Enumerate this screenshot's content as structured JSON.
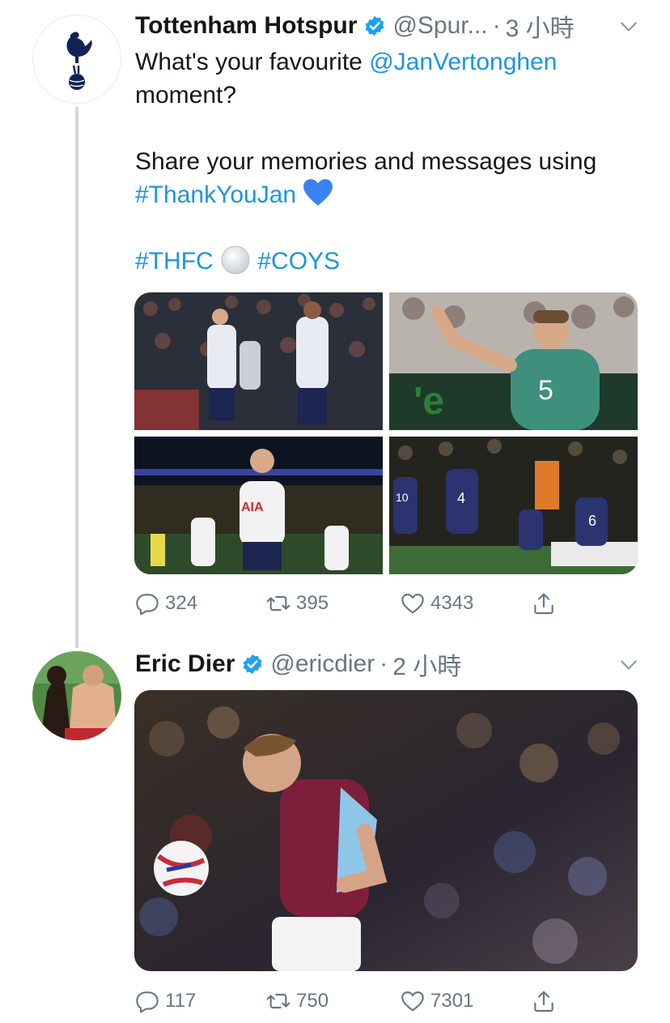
{
  "tweets": [
    {
      "author": "Tottenham Hotspur",
      "handle": "@Spur...",
      "time": "3 小時",
      "text": {
        "line1_prefix": "What's your favourite ",
        "mention": "@JanVertonghen",
        "line2": "moment?",
        "line3": "Share your memories and messages using",
        "hashtag1": "#ThankYouJan",
        "hashtag2": "#THFC",
        "hashtag3": "#COYS"
      },
      "media": [
        {
          "alt": "photo-celebration-1"
        },
        {
          "alt": "photo-vertonghen-5"
        },
        {
          "alt": "photo-vertonghen-stadium"
        },
        {
          "alt": "photo-team-celebration"
        }
      ],
      "stats": {
        "replies": "324",
        "retweets": "395",
        "likes": "4343"
      }
    },
    {
      "author": "Eric Dier",
      "handle": "@ericdier",
      "time": "2 小時",
      "media": [
        {
          "alt": "photo-player-ball"
        }
      ],
      "stats": {
        "replies": "117",
        "retweets": "750",
        "likes": "7301"
      }
    }
  ],
  "colors": {
    "link": "#1b95e0",
    "muted": "#657786",
    "verified": "#1da1f2"
  },
  "icons": [
    "verified-badge-icon",
    "chevron-down-icon",
    "reply-icon",
    "retweet-icon",
    "like-icon",
    "share-icon"
  ]
}
